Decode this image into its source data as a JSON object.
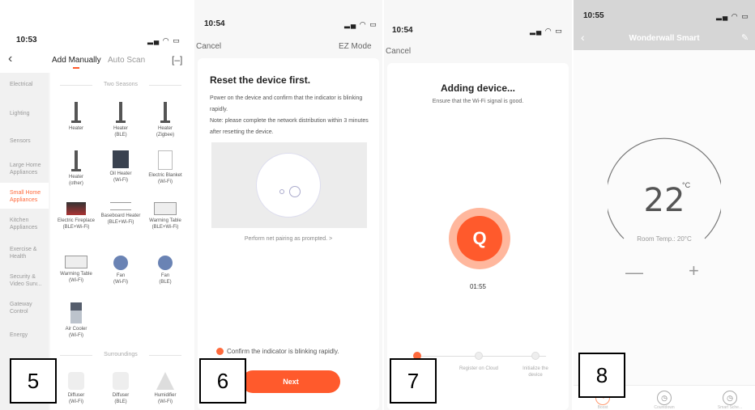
{
  "panel1": {
    "time": "10:53",
    "tabs": {
      "manual": "Add Manually",
      "auto": "Auto Scan"
    },
    "sidebar": [
      "Electrical",
      "Lighting",
      "Sensors",
      "Large Home Appliances",
      "Small Home Appliances",
      "Kitchen Appliances",
      "Exercise & Health",
      "Security & Video Surv...",
      "Gateway Control",
      "Energy"
    ],
    "section1": "Two Seasons",
    "devices": [
      {
        "name": "Heater",
        "sub": "",
        "icon": "heater-icon"
      },
      {
        "name": "Heater",
        "sub": "(BLE)",
        "icon": "heater-icon"
      },
      {
        "name": "Heater",
        "sub": "(Zigbee)",
        "icon": "heater-icon"
      },
      {
        "name": "Heater",
        "sub": "(other)",
        "icon": "heater-icon"
      },
      {
        "name": "Oil Heater",
        "sub": "(Wi-Fi)",
        "icon": "oil-heater-icon"
      },
      {
        "name": "Electric Blanket",
        "sub": "(Wi-Fi)",
        "icon": "blanket-icon"
      },
      {
        "name": "Electric Fireplace",
        "sub": "(BLE+Wi-Fi)",
        "icon": "fireplace-icon"
      },
      {
        "name": "Baseboard Heater",
        "sub": "(BLE+Wi-Fi)",
        "icon": "baseboard-icon"
      },
      {
        "name": "Warming Table",
        "sub": "(BLE+Wi-Fi)",
        "icon": "warming-table-icon"
      },
      {
        "name": "Warming Table",
        "sub": "(Wi-Fi)",
        "icon": "warming-table-icon"
      },
      {
        "name": "Fan",
        "sub": "(Wi-Fi)",
        "icon": "fan-icon"
      },
      {
        "name": "Fan",
        "sub": "(BLE)",
        "icon": "fan-icon"
      },
      {
        "name": "Air Cooler",
        "sub": "(Wi-Fi)",
        "icon": "air-cooler-icon"
      }
    ],
    "section2": "Surroundings",
    "devices2": [
      {
        "name": "Diffuser",
        "sub": "(Wi-Fi)"
      },
      {
        "name": "Diffuser",
        "sub": "(BLE)"
      },
      {
        "name": "Humidifier",
        "sub": "(Wi-Fi)"
      }
    ]
  },
  "panel2": {
    "time": "10:54",
    "cancel": "Cancel",
    "mode": "EZ Mode",
    "title": "Reset the device first.",
    "desc1": "Power on the device and confirm that the indicator is blinking rapidly.",
    "desc2": "Note: please complete the network distribution within 3 minutes after resetting the device.",
    "prompt_link": "Perform net pairing as prompted. >",
    "confirm": "Confirm the indicator is blinking rapidly.",
    "next": "Next"
  },
  "panel3": {
    "time": "10:54",
    "cancel": "Cancel",
    "title": "Adding device...",
    "subtitle": "Ensure that the Wi-Fi signal is good.",
    "timer": "01:55",
    "steps": [
      "Register on Cloud",
      "Initialize the device"
    ]
  },
  "panel4": {
    "time": "10:55",
    "title": "Wonderwall Smart",
    "temperature": "22",
    "unit": "°C",
    "room_temp": "Room Temp.: 20°C",
    "minus": "—",
    "plus": "+",
    "nav": [
      "Boost",
      "Countdown",
      "Smart Sche..."
    ]
  },
  "labels": [
    "5",
    "6",
    "7",
    "8"
  ]
}
